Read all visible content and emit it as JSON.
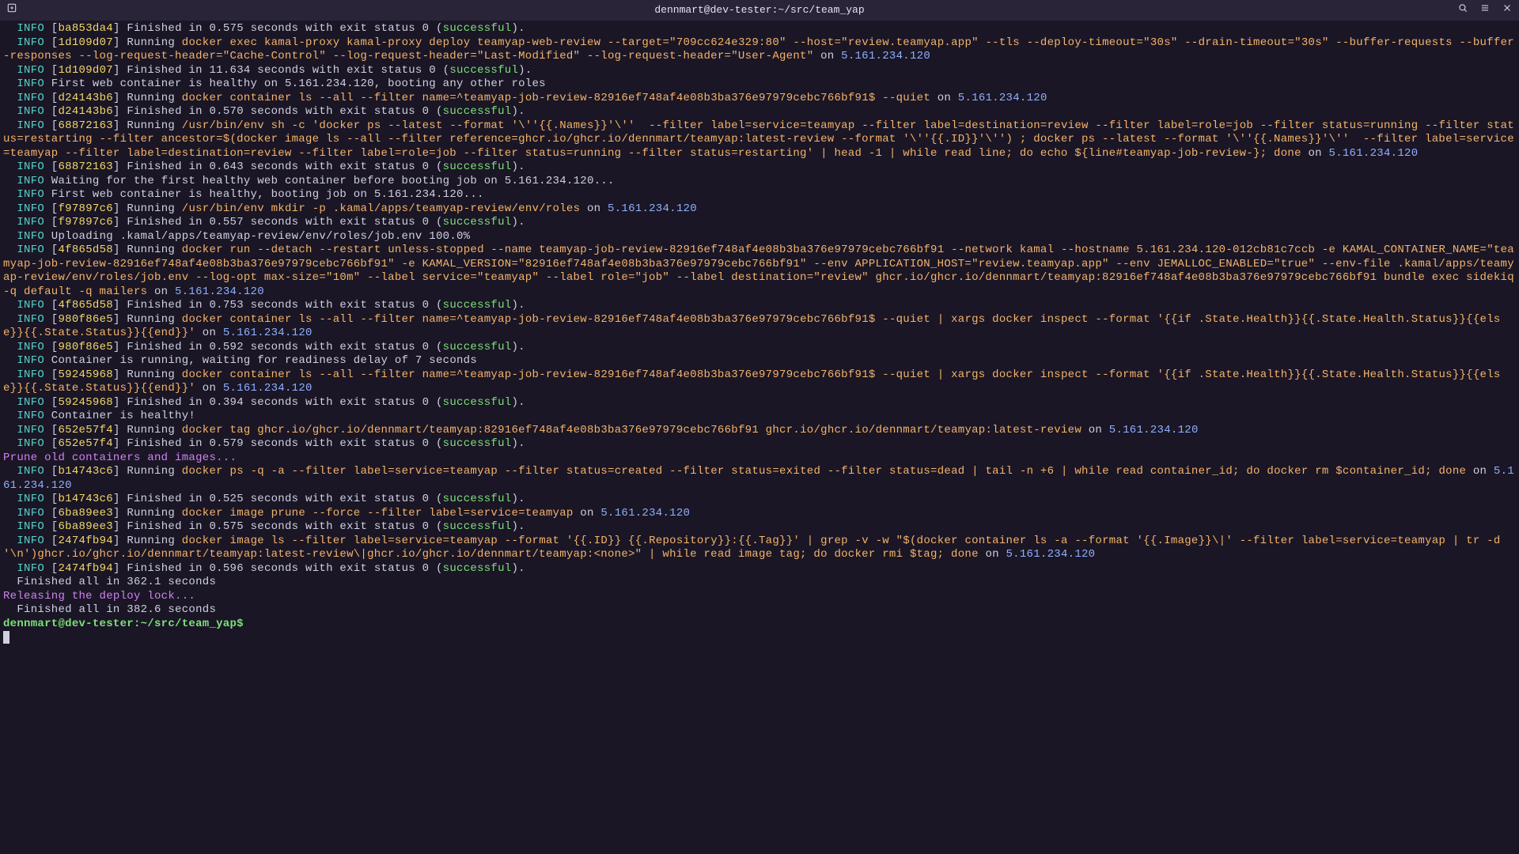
{
  "title": "dennmart@dev-tester:~/src/team_yap",
  "host_ip": "5.161.234.120",
  "prompt": "dennmart@dev-tester:~/src/team_yap$",
  "lines": [
    {
      "t": "fin",
      "hash": "ba853da4",
      "secs": "0.575"
    },
    {
      "t": "run",
      "hash": "1d109d07",
      "cmd": "docker exec kamal-proxy kamal-proxy deploy teamyap-web-review --target=\"709cc624e329:80\" --host=\"review.teamyap.app\" --tls --deploy-timeout=\"30s\" --drain-timeout=\"30s\" --buffer-requests --buffer-responses --log-request-header=\"Cache-Control\" --log-request-header=\"Last-Modified\" --log-request-header=\"User-Agent\"",
      "host": true
    },
    {
      "t": "fin",
      "hash": "1d109d07",
      "secs": "11.634"
    },
    {
      "t": "plain",
      "text": "First web container is healthy on 5.161.234.120, booting any other roles"
    },
    {
      "t": "run",
      "hash": "d24143b6",
      "cmd": "docker container ls --all --filter name=^teamyap-job-review-82916ef748af4e08b3ba376e97979cebc766bf91$ --quiet",
      "host": true
    },
    {
      "t": "fin",
      "hash": "d24143b6",
      "secs": "0.570"
    },
    {
      "t": "run",
      "hash": "68872163",
      "cmd": "/usr/bin/env sh -c 'docker ps --latest --format '\\''{{.Names}}'\\''  --filter label=service=teamyap --filter label=destination=review --filter label=role=job --filter status=running --filter status=restarting --filter ancestor=$(docker image ls --all --filter reference=ghcr.io/ghcr.io/dennmart/teamyap:latest-review --format '\\''{{.ID}}'\\'') ; docker ps --latest --format '\\''{{.Names}}'\\''  --filter label=service=teamyap --filter label=destination=review --filter label=role=job --filter status=running --filter status=restarting' | head -1 | while read line; do echo ${line#teamyap-job-review-}; done",
      "host": true
    },
    {
      "t": "fin",
      "hash": "68872163",
      "secs": "0.643"
    },
    {
      "t": "plain",
      "text": "Waiting for the first healthy web container before booting job on 5.161.234.120..."
    },
    {
      "t": "plain",
      "text": "First web container is healthy, booting job on 5.161.234.120..."
    },
    {
      "t": "run",
      "hash": "f97897c6",
      "cmd": "/usr/bin/env mkdir -p .kamal/apps/teamyap-review/env/roles",
      "host": true
    },
    {
      "t": "fin",
      "hash": "f97897c6",
      "secs": "0.557"
    },
    {
      "t": "plain",
      "text": "Uploading .kamal/apps/teamyap-review/env/roles/job.env 100.0%"
    },
    {
      "t": "run",
      "hash": "4f865d58",
      "cmd": "docker run --detach --restart unless-stopped --name teamyap-job-review-82916ef748af4e08b3ba376e97979cebc766bf91 --network kamal --hostname 5.161.234.120-012cb81c7ccb -e KAMAL_CONTAINER_NAME=\"teamyap-job-review-82916ef748af4e08b3ba376e97979cebc766bf91\" -e KAMAL_VERSION=\"82916ef748af4e08b3ba376e97979cebc766bf91\" --env APPLICATION_HOST=\"review.teamyap.app\" --env JEMALLOC_ENABLED=\"true\" --env-file .kamal/apps/teamyap-review/env/roles/job.env --log-opt max-size=\"10m\" --label service=\"teamyap\" --label role=\"job\" --label destination=\"review\" ghcr.io/ghcr.io/dennmart/teamyap:82916ef748af4e08b3ba376e97979cebc766bf91 bundle exec sidekiq -q default -q mailers",
      "host": true
    },
    {
      "t": "fin",
      "hash": "4f865d58",
      "secs": "0.753"
    },
    {
      "t": "run",
      "hash": "980f86e5",
      "cmd": "docker container ls --all --filter name=^teamyap-job-review-82916ef748af4e08b3ba376e97979cebc766bf91$ --quiet | xargs docker inspect --format '{{if .State.Health}}{{.State.Health.Status}}{{else}}{{.State.Status}}{{end}}'",
      "host": true
    },
    {
      "t": "fin",
      "hash": "980f86e5",
      "secs": "0.592"
    },
    {
      "t": "plain",
      "text": "Container is running, waiting for readiness delay of 7 seconds"
    },
    {
      "t": "run",
      "hash": "59245968",
      "cmd": "docker container ls --all --filter name=^teamyap-job-review-82916ef748af4e08b3ba376e97979cebc766bf91$ --quiet | xargs docker inspect --format '{{if .State.Health}}{{.State.Health.Status}}{{else}}{{.State.Status}}{{end}}'",
      "host": true
    },
    {
      "t": "fin",
      "hash": "59245968",
      "secs": "0.394"
    },
    {
      "t": "plain",
      "text": "Container is healthy!"
    },
    {
      "t": "run",
      "hash": "652e57f4",
      "cmd": "docker tag ghcr.io/ghcr.io/dennmart/teamyap:82916ef748af4e08b3ba376e97979cebc766bf91 ghcr.io/ghcr.io/dennmart/teamyap:latest-review",
      "host": true
    },
    {
      "t": "fin",
      "hash": "652e57f4",
      "secs": "0.579"
    },
    {
      "t": "purple",
      "text": "Prune old containers and images..."
    },
    {
      "t": "run",
      "hash": "b14743c6",
      "cmd": "docker ps -q -a --filter label=service=teamyap --filter status=created --filter status=exited --filter status=dead | tail -n +6 | while read container_id; do docker rm $container_id; done",
      "host": true
    },
    {
      "t": "fin",
      "hash": "b14743c6",
      "secs": "0.525"
    },
    {
      "t": "run",
      "hash": "6ba89ee3",
      "cmd": "docker image prune --force --filter label=service=teamyap",
      "host": true
    },
    {
      "t": "fin",
      "hash": "6ba89ee3",
      "secs": "0.575"
    },
    {
      "t": "run",
      "hash": "2474fb94",
      "cmd": "docker image ls --filter label=service=teamyap --format '{{.ID}} {{.Repository}}:{{.Tag}}' | grep -v -w \"$(docker container ls -a --format '{{.Image}}\\|' --filter label=service=teamyap | tr -d '\\n')ghcr.io/ghcr.io/dennmart/teamyap:latest-review\\|ghcr.io/ghcr.io/dennmart/teamyap:<none>\" | while read image tag; do docker rmi $tag; done",
      "host": true
    },
    {
      "t": "fin",
      "hash": "2474fb94",
      "secs": "0.596"
    },
    {
      "t": "rawplain",
      "text": "  Finished all in 362.1 seconds"
    },
    {
      "t": "purple",
      "text": "Releasing the deploy lock..."
    },
    {
      "t": "rawplain",
      "text": "  Finished all in 382.6 seconds"
    }
  ],
  "labels": {
    "info": "INFO",
    "running": "Running",
    "finished_prefix": "Finished in ",
    "finished_suffix": " seconds with exit status 0 (",
    "successful": "successful",
    "close_paren": ").",
    "on": " on "
  }
}
